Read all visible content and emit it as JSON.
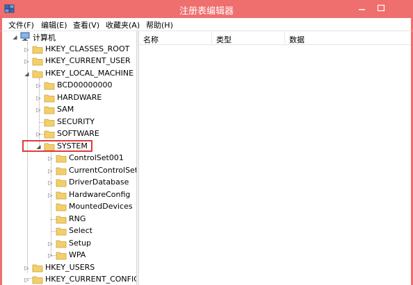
{
  "window": {
    "title": "注册表编辑器",
    "accent_color": "#ef6e6e",
    "app_icon": "regedit-icon"
  },
  "menu": [
    "文件(F)",
    "编辑(E)",
    "查看(V)",
    "收藏夹(A)",
    "帮助(H)"
  ],
  "tree": {
    "root": "计算机",
    "hives": {
      "classes_root": "HKEY_CLASSES_ROOT",
      "current_user": "HKEY_CURRENT_USER",
      "local_machine": "HKEY_LOCAL_MACHINE",
      "users": "HKEY_USERS",
      "current_config": "HKEY_CURRENT_CONFIG"
    },
    "local_machine_children": [
      "BCD00000000",
      "HARDWARE",
      "SAM",
      "SECURITY",
      "SOFTWARE",
      "SYSTEM"
    ],
    "system_children": [
      "ControlSet001",
      "CurrentControlSet",
      "DriverDatabase",
      "HardwareConfig",
      "MountedDevices",
      "RNG",
      "Select",
      "Setup",
      "WPA"
    ],
    "selected": "SYSTEM",
    "highlight_color": "#e03a3a"
  },
  "list": {
    "columns": [
      "名称",
      "类型",
      "数据"
    ]
  }
}
